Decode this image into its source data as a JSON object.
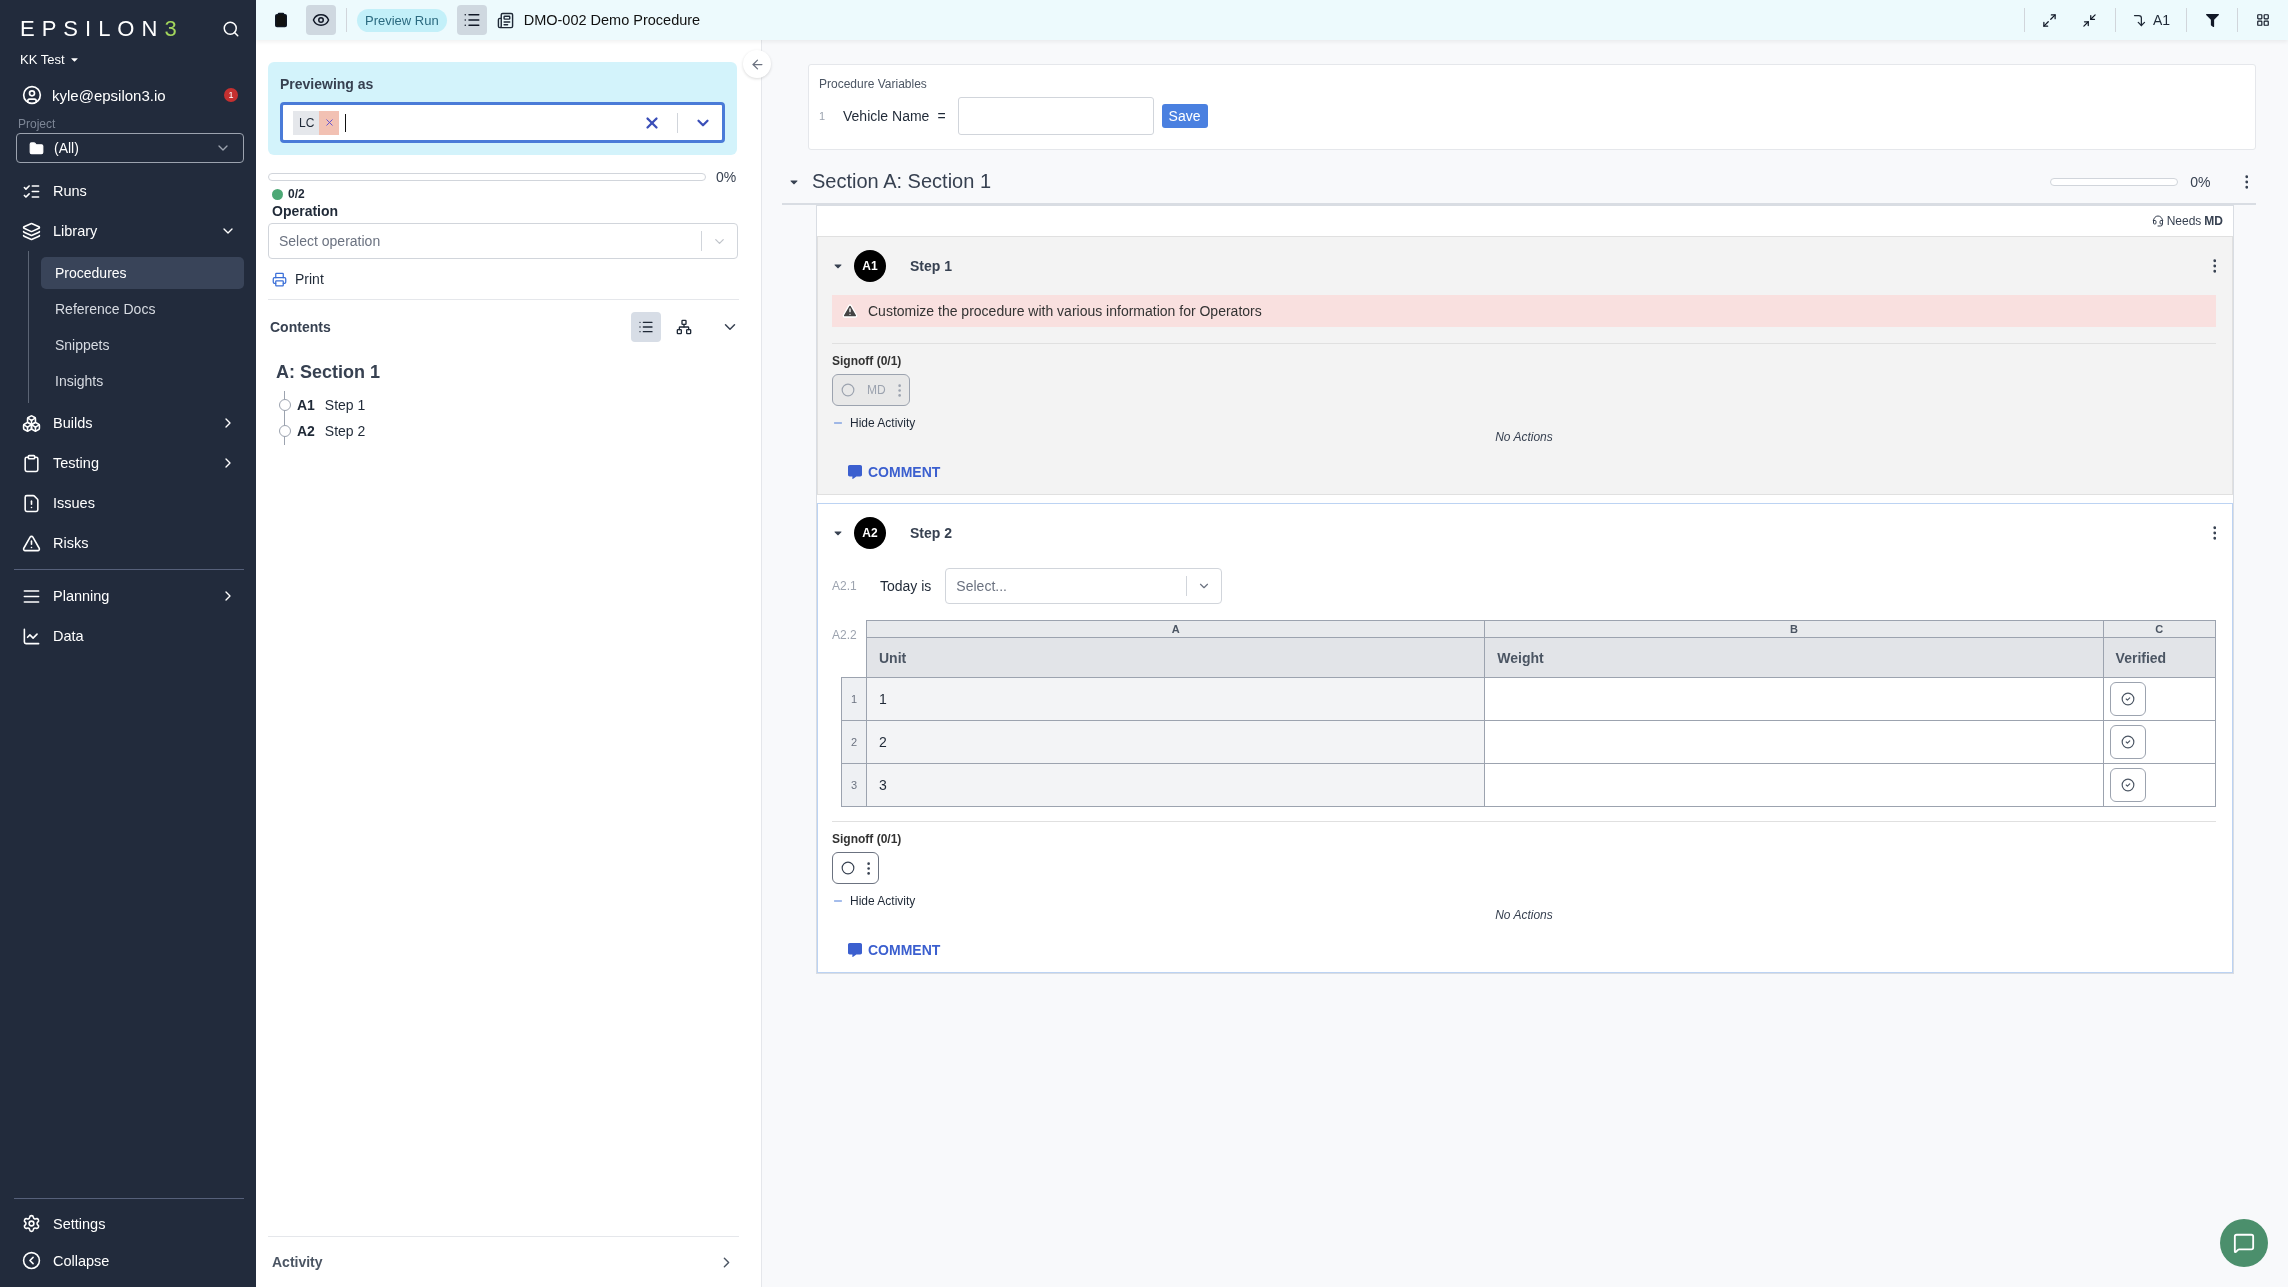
{
  "sidebar": {
    "logo": "EPSILON3",
    "workspace": "KK Test",
    "user": {
      "email": "kyle@epsilon3.io",
      "badge": "1"
    },
    "project": {
      "label": "Project",
      "value": "(All)"
    },
    "nav": [
      {
        "label": "Runs",
        "kind": "link",
        "selected": false
      },
      {
        "label": "Library",
        "kind": "group",
        "expanded": true,
        "selected": false,
        "children": [
          {
            "label": "Procedures",
            "selected": true
          },
          {
            "label": "Reference Docs",
            "selected": false
          },
          {
            "label": "Snippets",
            "selected": false
          },
          {
            "label": "Insights",
            "selected": false
          }
        ]
      },
      {
        "label": "Builds",
        "kind": "group",
        "expanded": false,
        "selected": false
      },
      {
        "label": "Testing",
        "kind": "group",
        "expanded": false,
        "selected": false
      },
      {
        "label": "Issues",
        "kind": "link",
        "selected": false
      },
      {
        "label": "Risks",
        "kind": "link",
        "selected": false
      }
    ],
    "nav_secondary": [
      {
        "label": "Planning",
        "kind": "group",
        "expanded": false,
        "selected": false
      },
      {
        "label": "Data",
        "kind": "link",
        "selected": false
      }
    ],
    "footer": [
      "Settings",
      "Collapse"
    ]
  },
  "toolbar": {
    "mode": "Preview Run",
    "title": "DMO-002 Demo Procedure",
    "jump": "A1",
    "preview_on": true,
    "list_on": true
  },
  "panel": {
    "preview": {
      "label": "Previewing as",
      "tags": [
        "LC"
      ]
    },
    "progress": {
      "level": 0,
      "reading": "0%",
      "count": "0/2"
    },
    "operation": {
      "label": "Operation",
      "placeholder": "Select operation"
    },
    "print": "Print",
    "contents": {
      "title": "Contents",
      "views": [
        {
          "kind": "list",
          "selected": true
        },
        {
          "kind": "tree",
          "selected": false
        }
      ],
      "section": "A: Section 1",
      "steps": [
        {
          "id": "A1",
          "title": "Step 1"
        },
        {
          "id": "A2",
          "title": "Step 2"
        }
      ]
    },
    "activity": "Activity"
  },
  "variables": {
    "title": "Procedure Variables",
    "items": [
      {
        "index": "1",
        "name": "Vehicle Name",
        "operator": "="
      }
    ],
    "save": "Save"
  },
  "section": {
    "title": "Section A: Section 1",
    "expanded": true,
    "level": 0,
    "reading": "0%",
    "needs": {
      "label": "Needs",
      "role": "MD"
    },
    "steps": [
      {
        "id": "A1",
        "title": "Step 1",
        "expanded": true,
        "disabled": true,
        "blocks": [
          {
            "kind": "alert",
            "text": "Customize the procedure with various information for Operators"
          }
        ],
        "signoff": {
          "label": "Signoff (0/1)",
          "role": "MD",
          "checked": false
        },
        "activity_toggle": "Hide Activity",
        "activity_empty": "No Actions",
        "comment": "COMMENT"
      },
      {
        "id": "A2",
        "title": "Step 2",
        "expanded": true,
        "disabled": false,
        "blocks": [
          {
            "kind": "select",
            "index": "A2.1",
            "label": "Today is",
            "placeholder": "Select..."
          },
          {
            "kind": "table",
            "index": "A2.2",
            "columns": [
              {
                "letter": "A",
                "name": "Unit"
              },
              {
                "letter": "B",
                "name": "Weight"
              },
              {
                "letter": "C",
                "name": "Verified"
              }
            ],
            "rows": [
              {
                "number": "1",
                "unit": "1"
              },
              {
                "number": "2",
                "unit": "2"
              },
              {
                "number": "3",
                "unit": "3"
              }
            ]
          }
        ],
        "signoff": {
          "label": "Signoff (0/1)",
          "checked": false
        },
        "activity_toggle": "Hide Activity",
        "activity_empty": "No Actions",
        "comment": "COMMENT"
      }
    ]
  }
}
